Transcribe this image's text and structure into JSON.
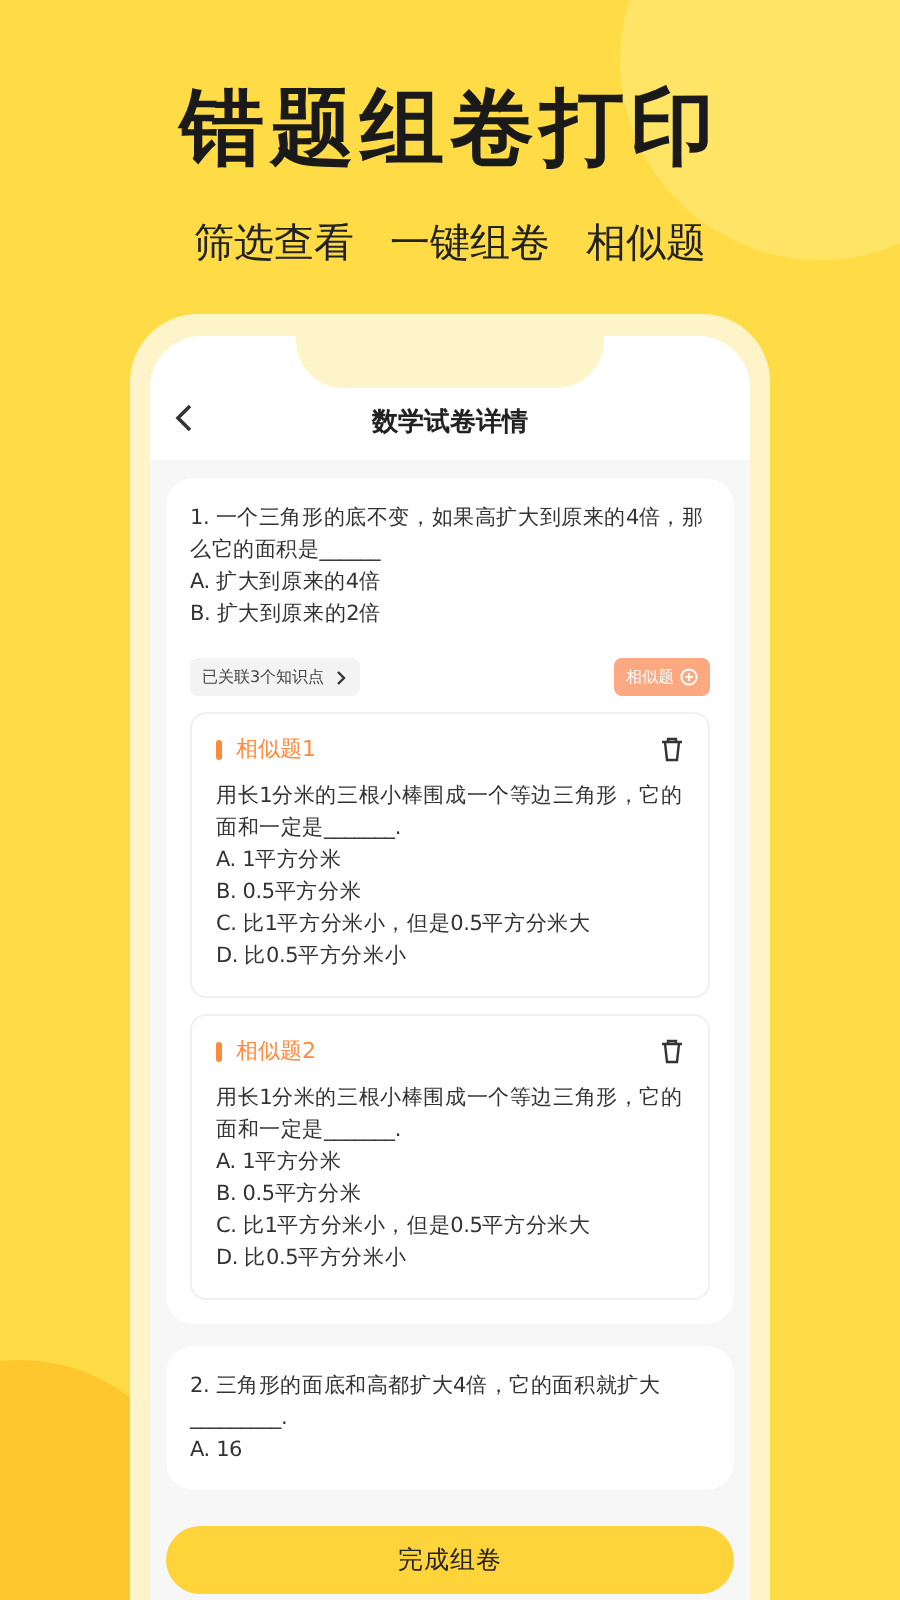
{
  "hero": {
    "title": "错题组卷打印",
    "subtitle": [
      "筛选查看",
      "一键组卷",
      "相似题"
    ]
  },
  "nav": {
    "title": "数学试卷详情"
  },
  "questions": [
    {
      "stem": "1. 一个三角形的底不变，如果高扩大到原来的4倍，那么它的面积是______",
      "options": [
        "A. 扩大到原来的4倍",
        "B. 扩大到原来的2倍"
      ],
      "tag": "已关联3个知识点",
      "similar_button": "相似题",
      "similar": [
        {
          "title": "相似题1",
          "stem": "用长1分米的三根小棒围成一个等边三角形，它的面和一定是_______.",
          "options": [
            "A. 1平方分米",
            "B. 0.5平方分米",
            "C. 比1平方分米小，但是0.5平方分米大",
            "D. 比0.5平方分米小"
          ]
        },
        {
          "title": "相似题2",
          "stem": "用长1分米的三根小棒围成一个等边三角形，它的面和一定是_______.",
          "options": [
            "A. 1平方分米",
            "B. 0.5平方分米",
            "C. 比1平方分米小，但是0.5平方分米大",
            "D. 比0.5平方分米小"
          ]
        }
      ]
    },
    {
      "stem": "2. 三角形的面底和高都扩大4倍，它的面积就扩大_________.",
      "options": [
        "A. 16"
      ]
    }
  ],
  "finish_button": "完成组卷"
}
